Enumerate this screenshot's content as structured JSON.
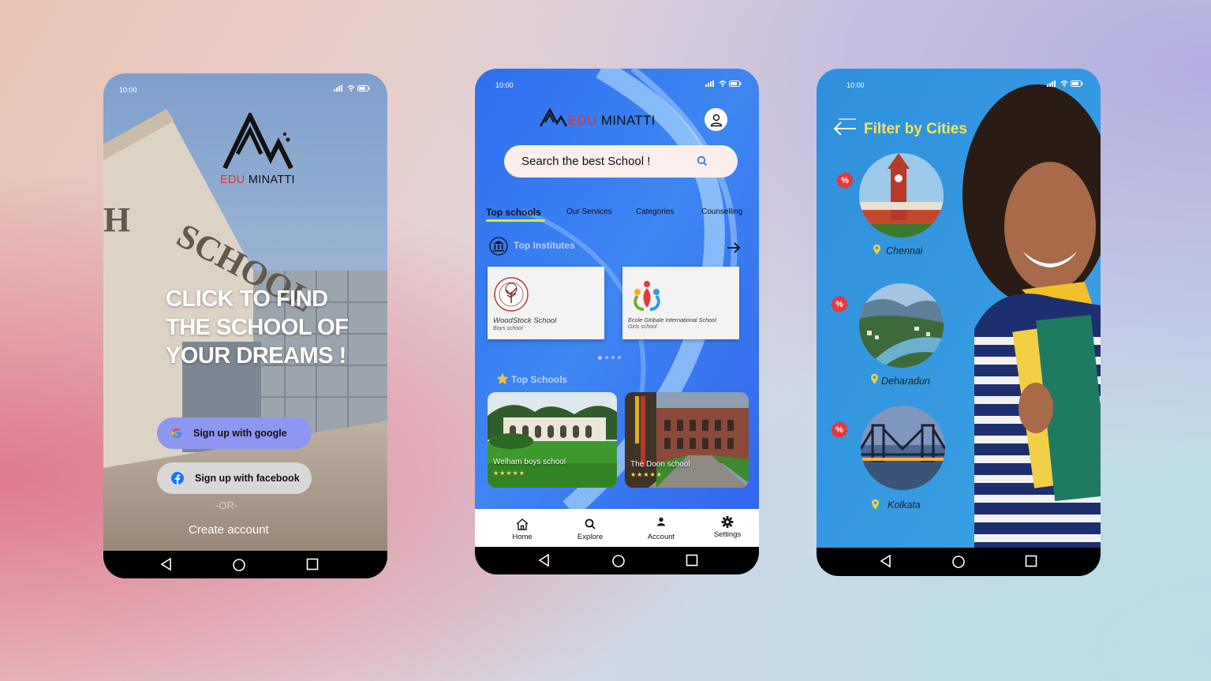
{
  "colors": {
    "accent_blue": "#3f7cf0",
    "google_button": "#8d96f0",
    "facebook_button": "#d8d8d8",
    "tab_underline": "#d8e84a",
    "filter_title": "#f5e45a",
    "discount_badge": "#e8353a",
    "brand_red": "#e63030"
  },
  "status_time": "10:00",
  "signup": {
    "brand_edu": "EDU",
    "brand_minatti": "MINATTI",
    "headline": "CLICK TO FIND THE SCHOOL OF YOUR DREAMS !",
    "google_label": "Sign up with google",
    "facebook_label": "Sign up with facebook",
    "or_text": "-OR-",
    "create_account": "Create account"
  },
  "home": {
    "brand_edu": "EDU",
    "brand_minatti": "MINATTI",
    "search_placeholder": "Search the best School !",
    "tabs": [
      {
        "label": "Top schools"
      },
      {
        "label": "Our Services"
      },
      {
        "label": "Categories"
      },
      {
        "label": "Counselling"
      }
    ],
    "top_institutes_title": "Top Institutes",
    "institutes": [
      {
        "name": "WoodStock School",
        "type": "Boys school"
      },
      {
        "name": "Ecole Globale International School",
        "type": "Girls school"
      }
    ],
    "top_schools_title": "Top Schools",
    "schools": [
      {
        "name": "Welham boys school",
        "rating": "★★★★★"
      },
      {
        "name": "The Doon school",
        "rating": "★★★★★"
      }
    ],
    "bottom_tabs": [
      {
        "label": "Home",
        "icon": "home-icon"
      },
      {
        "label": "Explore",
        "icon": "search-icon"
      },
      {
        "label": "Account",
        "icon": "user-icon"
      },
      {
        "label": "Settings",
        "icon": "gear-icon"
      }
    ]
  },
  "filter": {
    "title": "Filter by Cities",
    "discount_symbol": "%",
    "cities": [
      {
        "name": "Chennai"
      },
      {
        "name": "Deharadun"
      },
      {
        "name": "Kolkata"
      }
    ]
  }
}
